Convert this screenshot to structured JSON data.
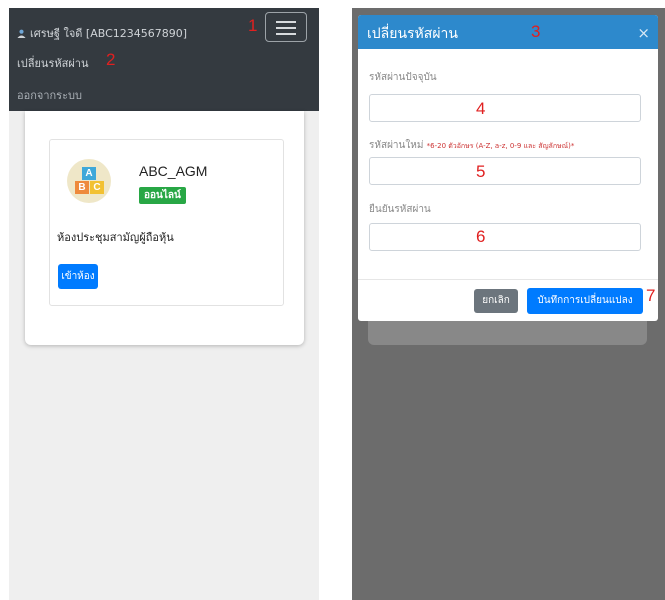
{
  "left": {
    "nav": {
      "user_label": "เศรษฐี ใจดี [ABC1234567890]",
      "change_password": "เปลี่ยนรหัสผ่าน",
      "logout": "ออกจากระบบ",
      "marker_menu": "1",
      "marker_change": "2"
    },
    "room": {
      "logo_letters": [
        "A",
        "B",
        "C"
      ],
      "name": "ABC_AGM",
      "status": "ออนไลน์",
      "title": "ห้องประชุมสามัญผู้ถือหุ้น",
      "enter_button": "เข้าห้อง"
    }
  },
  "modal": {
    "title": "เปลี่ยนรหัสผ่าน",
    "close": "×",
    "current_label": "รหัสผ่านปัจจุบัน",
    "new_label": "รหัสผ่านใหม่",
    "new_hint": "*6-20 ตัวอักษร (A-Z, a-z, 0-9 และ สัญลักษณ์)*",
    "confirm_label": "ยืนยันรหัสผ่าน",
    "cancel_button": "ยกเลิก",
    "save_button": "บันทึกการเปลี่ยนแปลง",
    "markers": [
      "3",
      "4",
      "5",
      "6",
      "7"
    ]
  },
  "colors": {
    "navbar": "#343a40",
    "modal_header": "#2d89cc",
    "primary": "#007bff",
    "success": "#28a745",
    "marker": "#e02020"
  }
}
